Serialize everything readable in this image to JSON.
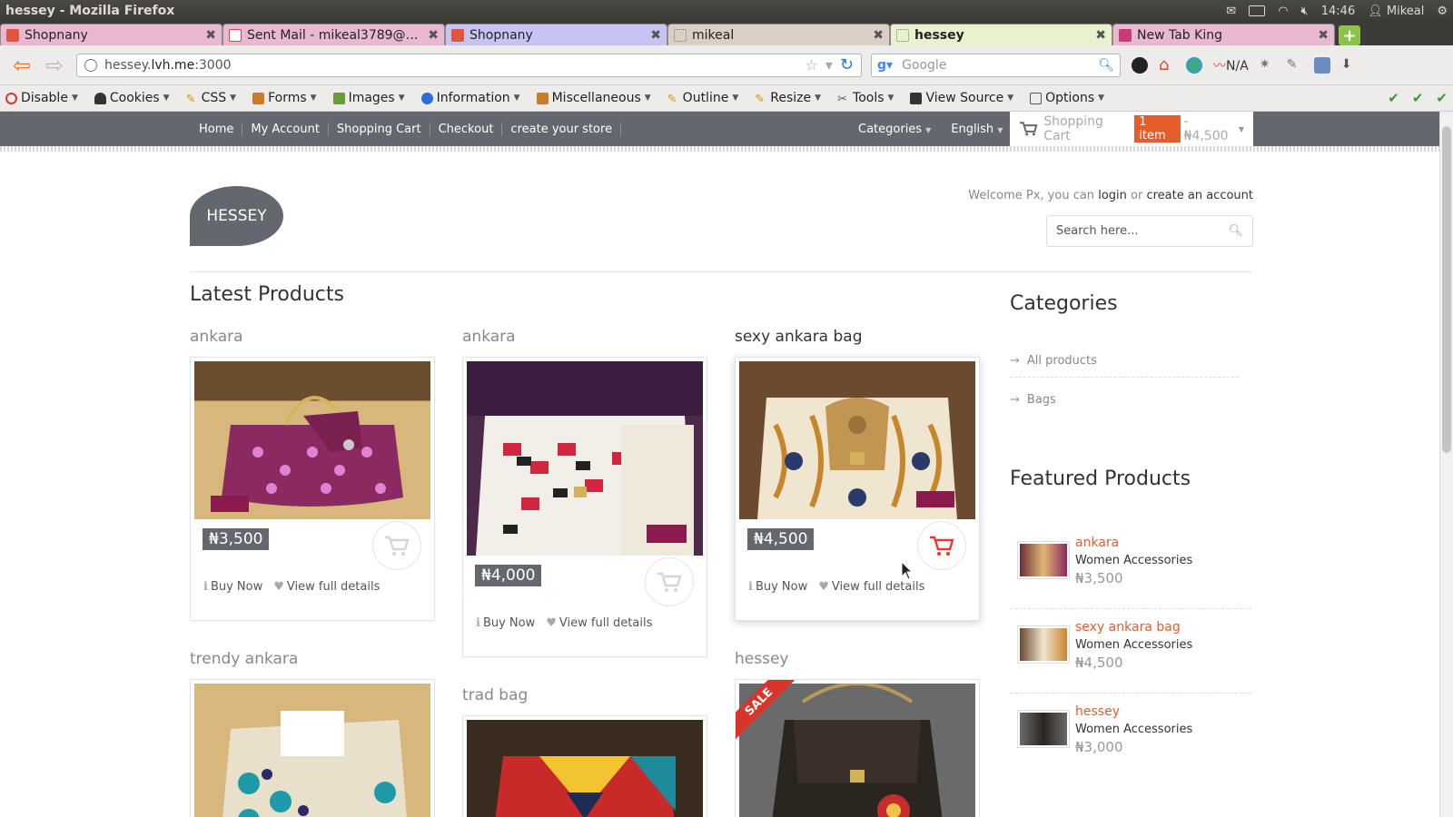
{
  "os": {
    "title": "hessey - Mozilla Firefox",
    "time": "14:46",
    "user": "Mikeal"
  },
  "tabs": [
    {
      "label": "Shopnany",
      "color": "#c46fa0"
    },
    {
      "label": "Sent Mail - mikeal3789@gm...",
      "color": "#c46fa0"
    },
    {
      "label": "Shopnany",
      "color": "#8d8ae0"
    },
    {
      "label": "mikeal",
      "color": "#b2a08c"
    },
    {
      "label": "hessey",
      "color": "#d6e6b1"
    },
    {
      "label": "New Tab King",
      "color": "#c46fa0"
    }
  ],
  "browser": {
    "url_prefix": "hessey.",
    "url_host": "lvh.me",
    "url_suffix": ":3000",
    "search_placeholder": "Google",
    "ext_na": "N/A"
  },
  "devbar": [
    "Disable",
    "Cookies",
    "CSS",
    "Forms",
    "Images",
    "Information",
    "Miscellaneous",
    "Outline",
    "Resize",
    "Tools",
    "View Source",
    "Options"
  ],
  "site": {
    "nav": [
      "Home",
      "My Account",
      "Shopping Cart",
      "Checkout",
      "create your store"
    ],
    "categories_label": "Categories",
    "language": "English",
    "cart_label": "Shopping Cart",
    "cart_badge": "1 item",
    "cart_total": "- ₦4,500",
    "logo": "HESSEY",
    "welcome_pre": "Welcome Px, you can",
    "login": "login",
    "or": "or",
    "create_account": "create an account",
    "search_placeholder": "Search here...",
    "latest_heading": "Latest Products",
    "buy_now": "Buy Now",
    "view_details": "View full details",
    "sale": "SALE"
  },
  "products": [
    {
      "title": "ankara",
      "price": "₦3,500"
    },
    {
      "title": "ankara",
      "price": "₦4,000"
    },
    {
      "title": "sexy ankara bag",
      "price": "₦4,500"
    },
    {
      "title": "trendy ankara"
    },
    {
      "title": "trad bag"
    },
    {
      "title": "hessey"
    }
  ],
  "sidebar": {
    "categories_heading": "Categories",
    "categories": [
      "All products",
      "Bags"
    ],
    "featured_heading": "Featured Products",
    "featured": [
      {
        "name": "ankara",
        "category": "Women Accessories",
        "price": "₦3,500"
      },
      {
        "name": "sexy ankara bag",
        "category": "Women Accessories",
        "price": "₦4,500"
      },
      {
        "name": "hessey",
        "category": "Women Accessories",
        "price": "₦3,000"
      }
    ]
  }
}
